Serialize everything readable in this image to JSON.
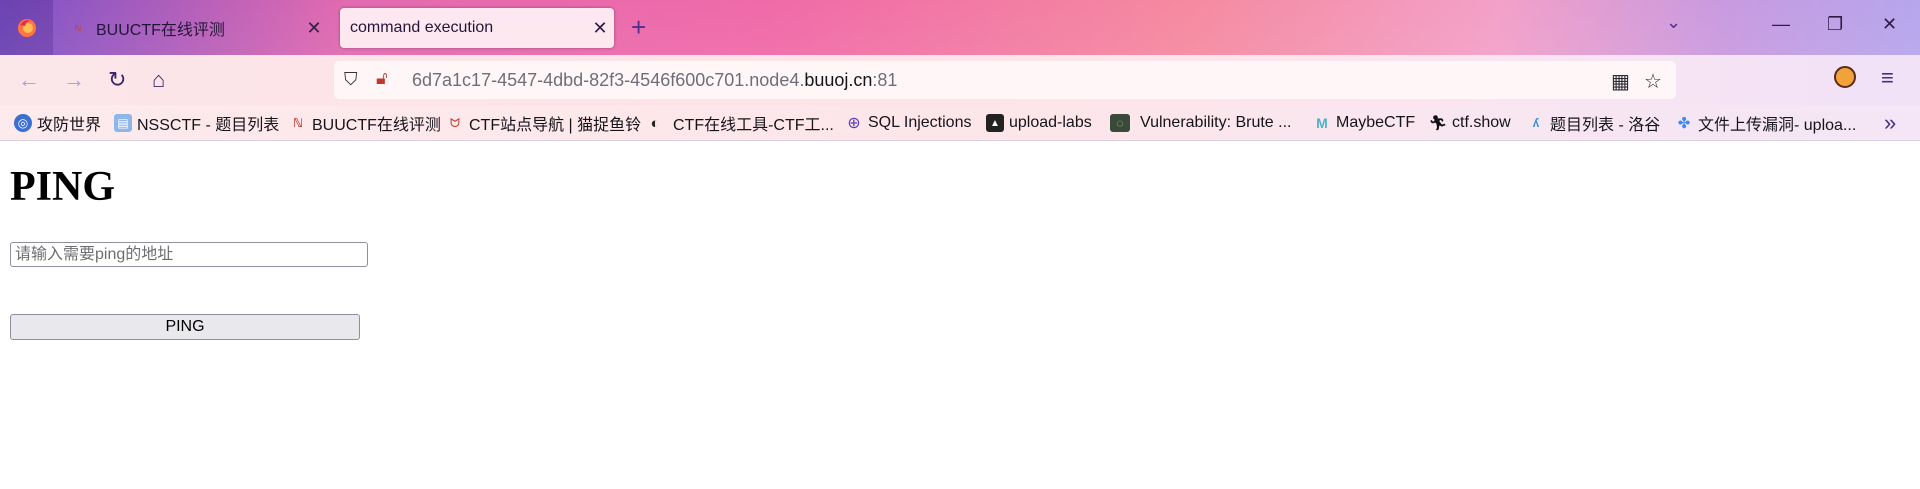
{
  "browser": {
    "tabs": [
      {
        "title": "BUUCTF在线评测",
        "favicon": "buuctf-icon",
        "active": false
      },
      {
        "title": "command execution",
        "favicon": "none",
        "active": true
      }
    ],
    "address": {
      "url_prefix": "6d7a1c17-4547-4dbd-82f3-4546f600c701.node4.",
      "url_host": "buuoj.cn",
      "url_suffix": ":81"
    },
    "bookmarks": [
      {
        "label": "攻防世界",
        "icon": "globe-icon"
      },
      {
        "label": "NSSCTF - 题目列表",
        "icon": "nss-icon"
      },
      {
        "label": "BUUCTF在线评测",
        "icon": "buuctf-icon"
      },
      {
        "label": "CTF站点导航 | 猫捉鱼铃",
        "icon": "cat-icon"
      },
      {
        "label": "CTF在线工具-CTF工...",
        "icon": "tool-icon"
      },
      {
        "label": "SQL Injections",
        "icon": "globe-icon"
      },
      {
        "label": "upload-labs",
        "icon": "upload-icon"
      },
      {
        "label": "Vulnerability: Brute ...",
        "icon": "dvwa-icon"
      },
      {
        "label": "MaybeCTF",
        "icon": "m-icon"
      },
      {
        "label": "ctf.show",
        "icon": "runner-icon"
      },
      {
        "label": "题目列表 - 洛谷",
        "icon": "luogu-icon"
      },
      {
        "label": "文件上传漏洞- uploa...",
        "icon": "google-icon"
      }
    ],
    "colors": {
      "accent": "#4b2a8a",
      "active_tab": "#fde7f0"
    }
  },
  "page": {
    "title": "PING",
    "input": {
      "placeholder": "请输入需要ping的地址",
      "value": ""
    },
    "button_label": "PING"
  }
}
